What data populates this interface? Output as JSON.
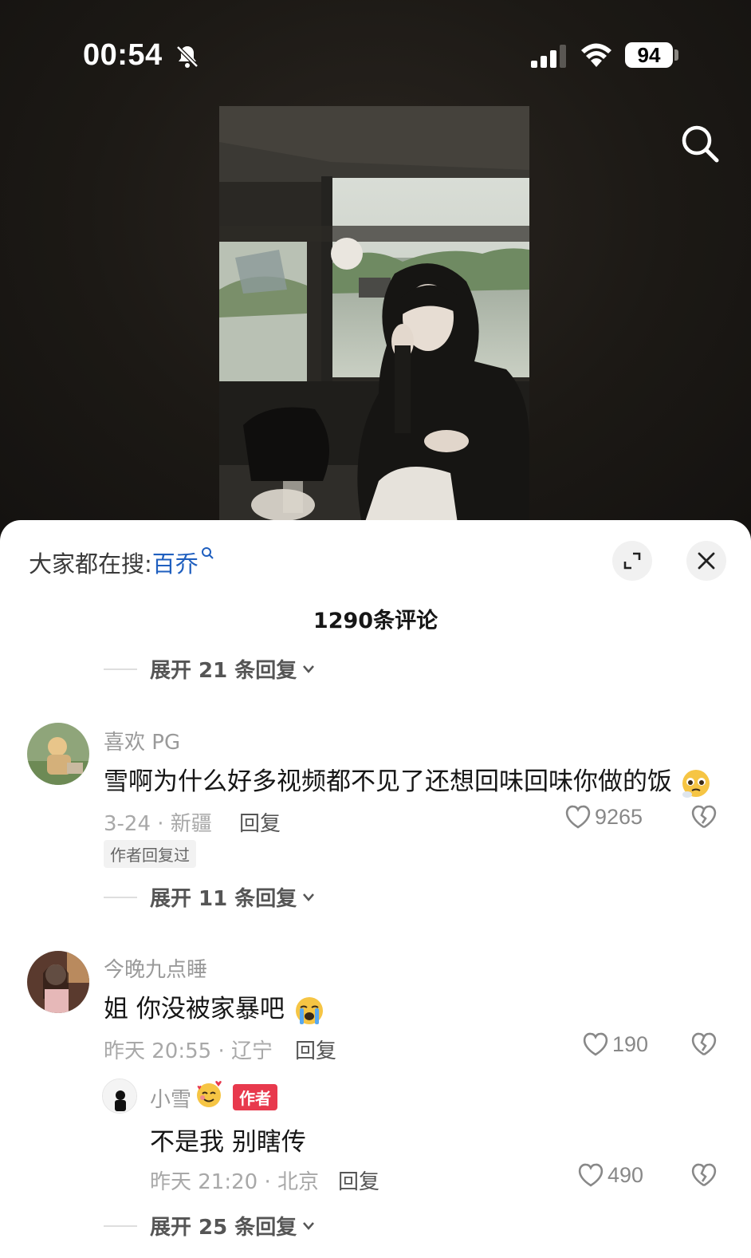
{
  "status_bar": {
    "time": "00:54",
    "battery": "94"
  },
  "icons": {
    "silent": "bell-off-icon",
    "signal": "signal-icon",
    "wifi": "wifi-icon",
    "search": "search-icon",
    "expand": "expand-icon",
    "close": "close-icon",
    "like": "heart-icon",
    "dislike": "broken-heart-icon",
    "chevron": "chevron-down-icon"
  },
  "sheet": {
    "search_prefix": "大家都在搜:",
    "search_keyword": "百乔",
    "comment_count": "1290条评论"
  },
  "threads": [
    {
      "expand_label": "展开 21 条回复"
    },
    {
      "username": "喜欢 PG",
      "text": "雪啊为什么好多视频都不见了还想回味回味你做的饭",
      "meta": "3-24 · 新疆",
      "reply_label": "回复",
      "likes": "9265",
      "tag": "作者回复过",
      "expand_label": "展开 11 条回复"
    },
    {
      "username": "今晚九点睡",
      "text": "姐 你没被家暴吧",
      "meta": "昨天 20:55 · 辽宁",
      "reply_label": "回复",
      "likes": "190",
      "reply": {
        "username": "小雪",
        "badge": "作者",
        "text": "不是我 别瞎传",
        "meta": "昨天 21:20 · 北京",
        "reply_label": "回复",
        "likes": "490"
      },
      "expand_label": "展开 25 条回复"
    }
  ],
  "colors": {
    "keyword": "#1f5fbf",
    "author_badge": "#e8394d",
    "video_bg": "#1c1915"
  }
}
